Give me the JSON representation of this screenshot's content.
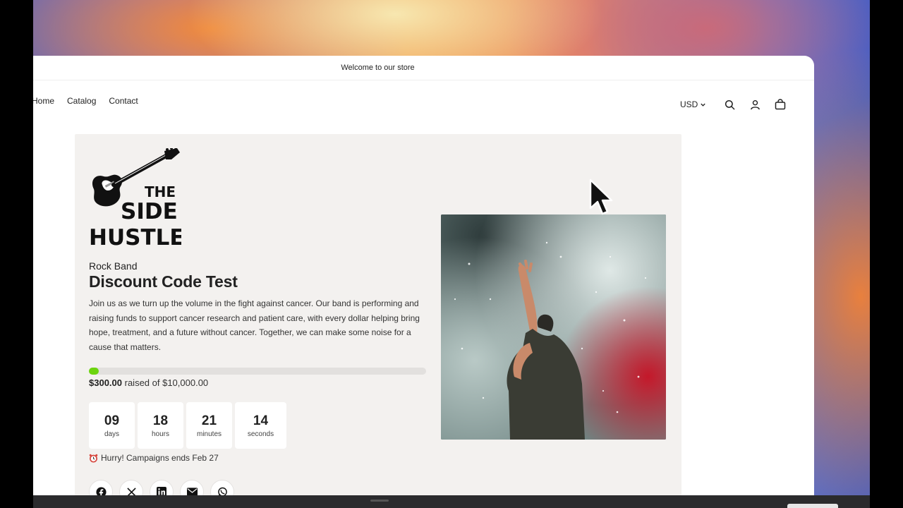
{
  "announcement": {
    "text": "Welcome to our store"
  },
  "nav": {
    "items": [
      "Home",
      "Catalog",
      "Contact"
    ]
  },
  "header": {
    "currency": "USD"
  },
  "logo": {
    "lines": [
      "THE",
      "SIDE",
      "HUSTLE"
    ]
  },
  "campaign": {
    "subtitle": "Rock Band",
    "title": "Discount Code Test",
    "description": "Join us as we turn up the volume in the fight against cancer. Our band is performing and raising funds to support cancer research and patient care, with every dollar helping bring hope, treatment, and a future without cancer. Together, we can make some noise for a cause that matters.",
    "raised_amount": "$300.00",
    "raised_text": "raised of $10,000.00",
    "progress_fraction": 0.03,
    "countdown": [
      {
        "value": "09",
        "label": "days"
      },
      {
        "value": "18",
        "label": "hours"
      },
      {
        "value": "21",
        "label": "minutes"
      },
      {
        "value": "14",
        "label": "seconds"
      }
    ],
    "hurry_text": "Hurry! Campaigns ends Feb 27",
    "socials": [
      "facebook-icon",
      "x-icon",
      "linkedin-icon",
      "email-icon",
      "whatsapp-icon"
    ]
  },
  "colors": {
    "progress": "#6cd40e",
    "panel": "#f3f1ef"
  }
}
